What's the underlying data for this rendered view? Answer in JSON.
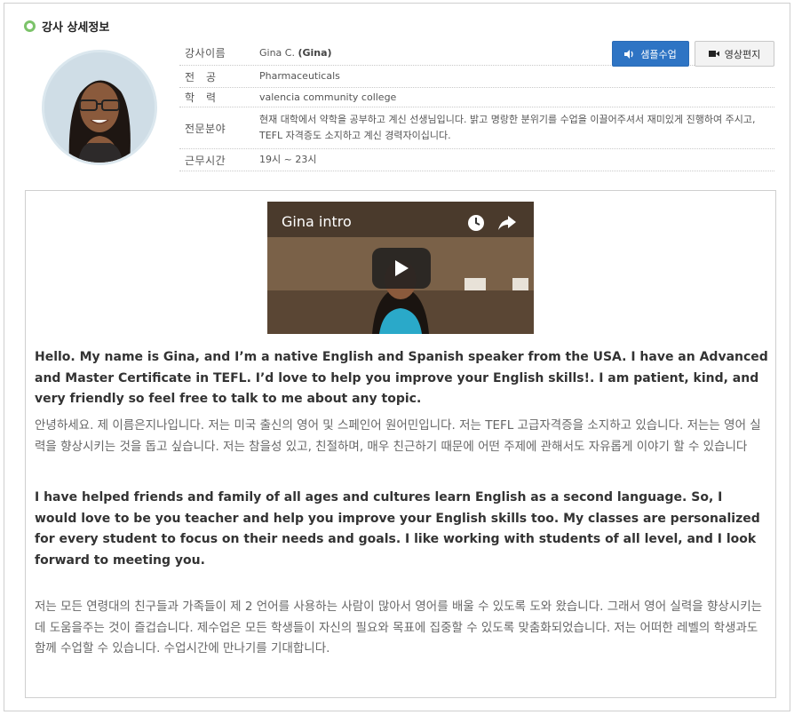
{
  "section": {
    "title": "강사 상세정보",
    "icon": "ring-icon"
  },
  "teacher": {
    "name_label": "강사이름",
    "name_prefix": "Gina C.",
    "name_nick": "(Gina)",
    "major_label": "전　공",
    "major": "Pharmaceuticals",
    "edu_label": "학　력",
    "edu": "valencia community college",
    "spec_label": "전문분야",
    "spec": "현재 대학에서 약학을 공부하고 계신 선생님입니다. 밝고 명랑한 분위기를 수업을 이끌어주셔서 재미있게 진행하여 주시고, TEFL 자격증도 소지하고 계신 경력자이십니다.",
    "time_label": "근무시간",
    "time": "19시 ~ 23시"
  },
  "buttons": {
    "sample": "샘플수업",
    "video_letter": "영상편지"
  },
  "video": {
    "title": "Gina intro"
  },
  "intro": {
    "p1_en": "Hello. My name is Gina, and I’m a native English and Spanish speaker from the USA. I have an Advanced and Master Certificate in TEFL. I’d love to help you improve your English skills!. I am patient, kind, and very friendly so feel free to talk to me about any topic.",
    "p2_ko": "안녕하세요. 제 이름은지나입니다. 저는 미국 출신의 영어 및 스페인어 원어민입니다. 저는 TEFL 고급자격증을 소지하고 있습니다. 저는는 영어 실력을 향상시키는 것을 돕고 싶습니다. 저는 참을성 있고, 친절하며, 매우 친근하기 때문에 어떤 주제에 관해서도 자유롭게 이야기 할 수 있습니다",
    "p3_en": "I have helped friends and family of all ages and cultures learn English as a second language. So, I would love to be you teacher and help you improve your English skills too. My classes are personalized for every student to focus on their needs and goals. I like working with students of all level, and I look forward to meeting you.",
    "p4_ko": "저는 모든 연령대의 친구들과 가족들이 제 2 언어를 사용하는 사람이 많아서 영어를 배울 수 있도록 도와 왔습니다. 그래서 영어 실력을 향상시키는 데 도움을주는 것이 즐겁습니다. 제수업은 모든 학생들이 자신의 필요와 목표에 집중할 수 있도록 맞춤화되었습니다. 저는 어떠한 레벨의 학생과도 함께 수업할 수 있습니다. 수업시간에 만나기를 기대합니다."
  },
  "colors": {
    "accent_blue": "#2e74c4",
    "ring_green": "#7cc36a"
  }
}
